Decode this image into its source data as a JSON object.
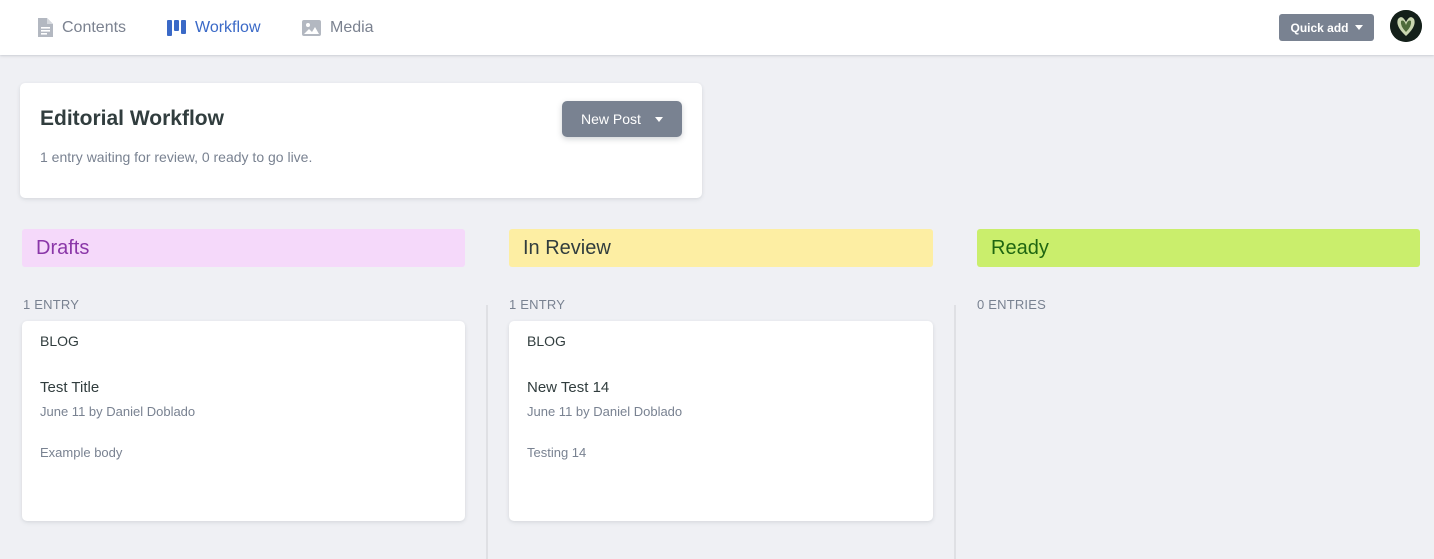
{
  "nav": {
    "items": [
      {
        "label": "Contents",
        "icon": "document-icon"
      },
      {
        "label": "Workflow",
        "icon": "workflow-icon"
      },
      {
        "label": "Media",
        "icon": "image-icon"
      }
    ],
    "quick_add": "Quick add"
  },
  "colors": {
    "accent": "#3a69c7",
    "drafts_bg": "#f5d9fa",
    "review_bg": "#fdeea3",
    "ready_bg": "#caee6c"
  },
  "header": {
    "title": "Editorial Workflow",
    "subtitle": "1 entry waiting for review, 0 ready to go live.",
    "new_post": "New Post"
  },
  "columns": [
    {
      "title": "Drafts",
      "count": "1 ENTRY",
      "cards": [
        {
          "collection": "BLOG",
          "title": "Test Title",
          "meta": "June 11 by Daniel Doblado",
          "body": "Example body"
        }
      ]
    },
    {
      "title": "In Review",
      "count": "1 ENTRY",
      "cards": [
        {
          "collection": "BLOG",
          "title": "New Test 14",
          "meta": "June 11 by Daniel Doblado",
          "body": "Testing 14"
        }
      ]
    },
    {
      "title": "Ready",
      "count": "0 ENTRIES",
      "cards": []
    }
  ]
}
